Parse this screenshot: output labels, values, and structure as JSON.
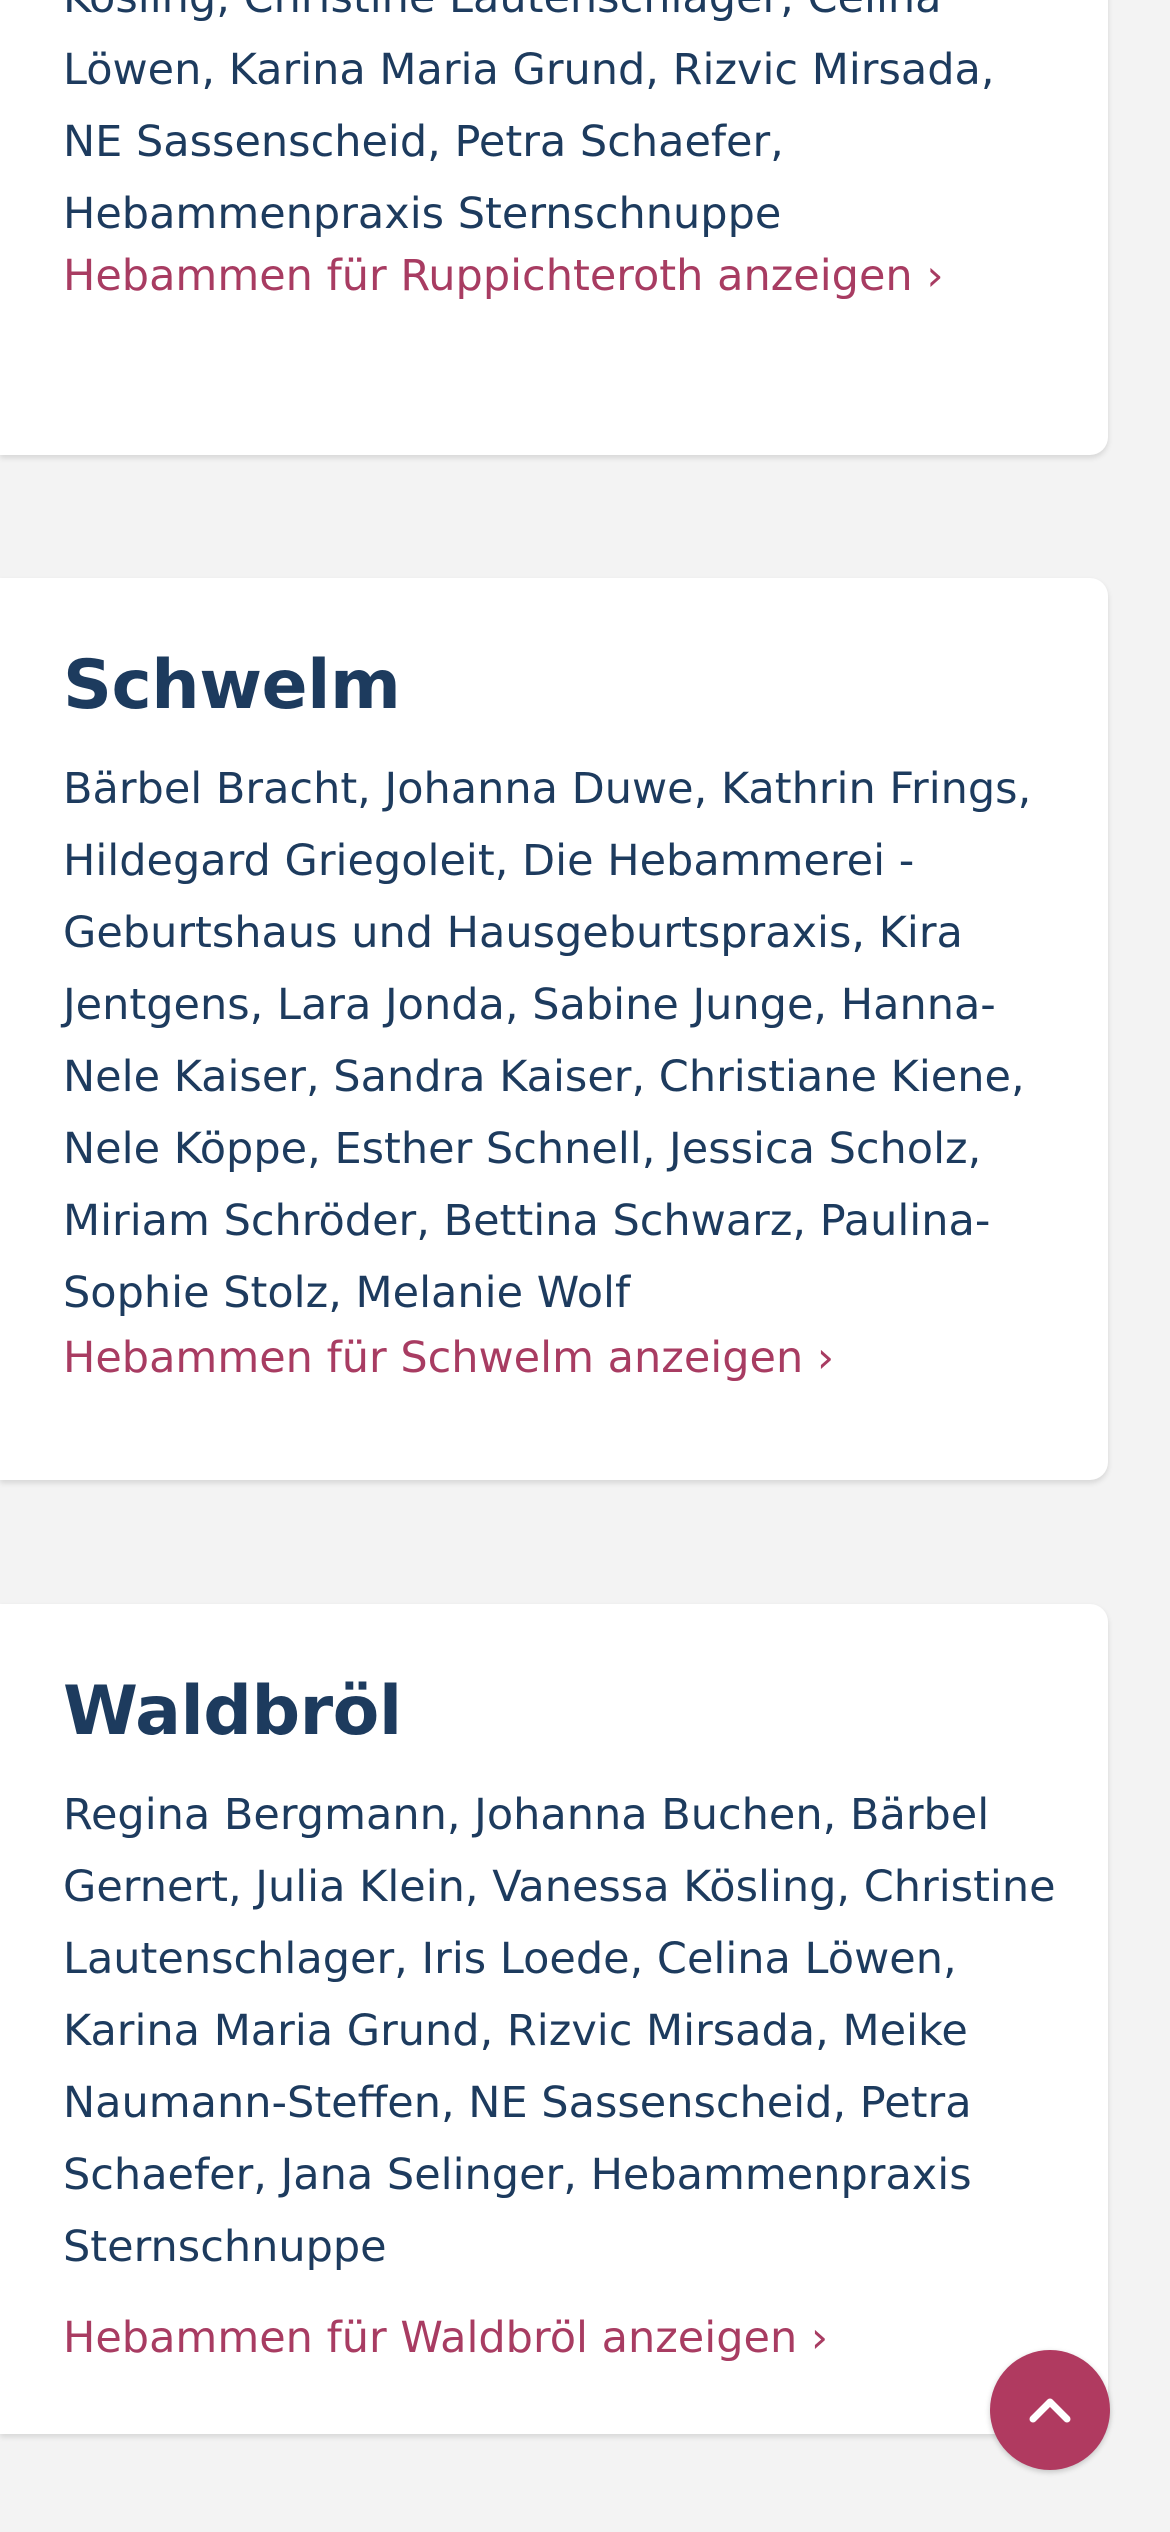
{
  "cards": [
    {
      "title": "",
      "names": "Sandra Dodenhoff, Sandra Kaiser, Vanessa Kösling, Christine Lautenschlager, Celina Löwen, Karina Maria Grund, Rizvic Mirsada, NE Sassenscheid, Petra Schaefer, Hebammenpraxis Sternschnuppe",
      "link": "Hebammen für Ruppichteroth anzeigen ›"
    },
    {
      "title": "Schwelm",
      "names": "Bärbel Bracht, Johanna Duwe, Kathrin Frings, Hildegard Griegoleit, Die Hebammerei - Geburtshaus und Hausgeburtspraxis, Kira Jentgens, Lara Jonda, Sabine Junge, Hanna-Nele Kaiser, Sandra Kaiser, Christiane Kiene, Nele Köppe, Esther Schnell, Jessica Scholz, Miriam Schröder, Bettina Schwarz, Paulina-Sophie Stolz, Melanie Wolf",
      "link": "Hebammen für Schwelm anzeigen ›"
    },
    {
      "title": "Waldbröl",
      "names": "Regina Bergmann, Johanna Buchen, Bärbel Gernert, Julia Klein, Vanessa Kösling, Christine Lautenschlager, Iris Loede, Celina Löwen, Karina Maria Grund, Rizvic Mirsada, Meike Naumann-Steffen, NE Sassenscheid, Petra Schaefer, Jana Selinger, Hebammenpraxis Sternschnuppe",
      "link": "Hebammen für Waldbröl anzeigen ›"
    }
  ],
  "scroll_top": {
    "icon": "chevron-up-icon"
  },
  "colors": {
    "heading": "#1d3b5e",
    "text": "#1d3b5e",
    "link": "#a83c62",
    "accent_button": "#b03a60",
    "background": "#f3f3f3",
    "card": "#ffffff"
  }
}
